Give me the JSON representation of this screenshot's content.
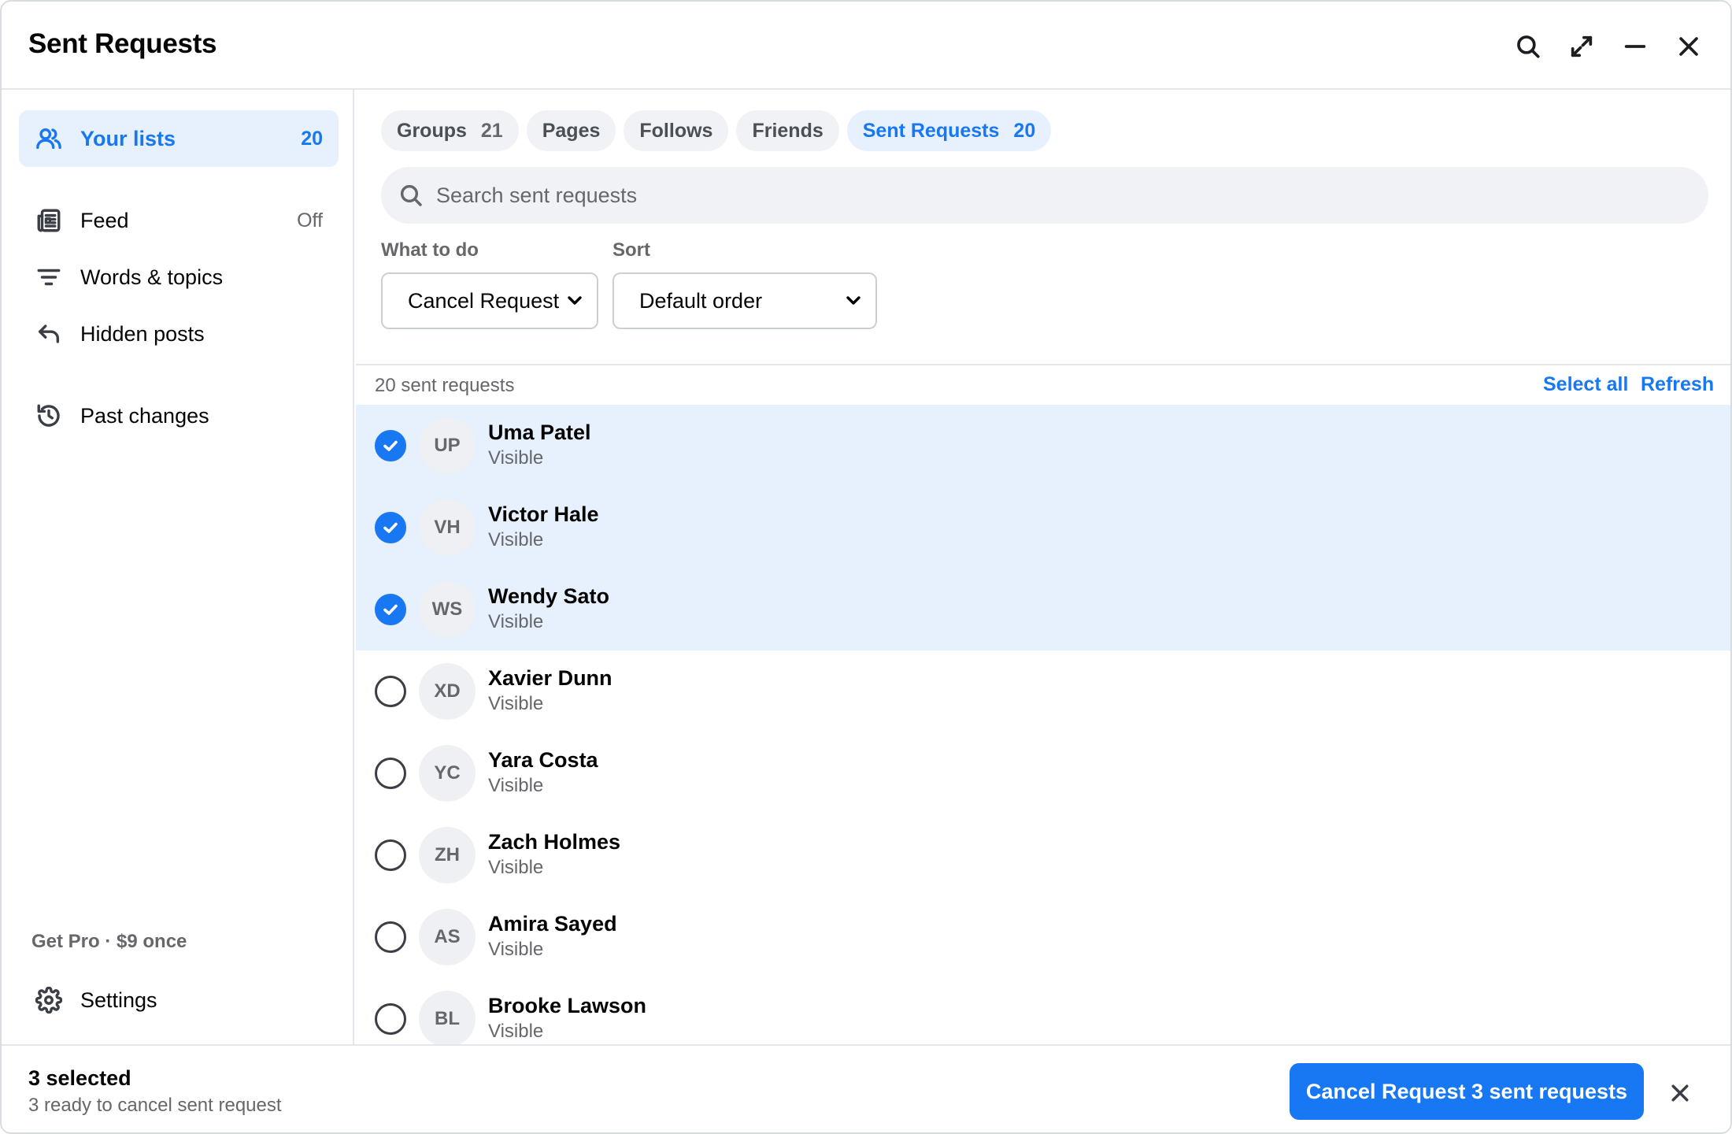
{
  "window": {
    "title": "Sent Requests"
  },
  "sidebar": {
    "items": [
      {
        "label": "Your lists",
        "count": "20",
        "icon": "people-icon",
        "active": true
      },
      {
        "label": "Feed",
        "count": "Off",
        "icon": "newspaper-icon"
      },
      {
        "label": "Words & topics",
        "count": "",
        "icon": "filter-lines-icon"
      },
      {
        "label": "Hidden posts",
        "count": "",
        "icon": "undo-arrow-icon"
      },
      {
        "label": "Past changes",
        "count": "",
        "icon": "history-icon"
      }
    ],
    "promo": "Get Pro · $9 once",
    "settings": {
      "label": "Settings",
      "icon": "gear-icon"
    }
  },
  "tabs": [
    {
      "label": "Groups",
      "count": "21"
    },
    {
      "label": "Pages",
      "count": ""
    },
    {
      "label": "Follows",
      "count": ""
    },
    {
      "label": "Friends",
      "count": ""
    },
    {
      "label": "Sent Requests",
      "count": "20",
      "active": true
    }
  ],
  "search": {
    "placeholder": "Search sent requests",
    "value": ""
  },
  "filters": {
    "action_label": "What to do",
    "action_value": "Cancel Request",
    "sort_label": "Sort",
    "sort_value": "Default order"
  },
  "list": {
    "count_text": "20 sent requests",
    "select_all": "Select all",
    "refresh": "Refresh",
    "rows": [
      {
        "initials": "UP",
        "name": "Uma Patel",
        "status": "Visible",
        "checked": true
      },
      {
        "initials": "VH",
        "name": "Victor Hale",
        "status": "Visible",
        "checked": true
      },
      {
        "initials": "WS",
        "name": "Wendy Sato",
        "status": "Visible",
        "checked": true
      },
      {
        "initials": "XD",
        "name": "Xavier Dunn",
        "status": "Visible",
        "checked": false
      },
      {
        "initials": "YC",
        "name": "Yara Costa",
        "status": "Visible",
        "checked": false
      },
      {
        "initials": "ZH",
        "name": "Zach Holmes",
        "status": "Visible",
        "checked": false
      },
      {
        "initials": "AS",
        "name": "Amira Sayed",
        "status": "Visible",
        "checked": false
      },
      {
        "initials": "BL",
        "name": "Brooke Lawson",
        "status": "Visible",
        "checked": false
      }
    ]
  },
  "footer": {
    "selected": "3 selected",
    "subtext": "3 ready to cancel sent request",
    "primary_button": "Cancel Request 3 sent requests"
  },
  "colors": {
    "accent": "#1877f2",
    "selected_row": "#e7f0fd",
    "muted_text": "#65676b"
  }
}
